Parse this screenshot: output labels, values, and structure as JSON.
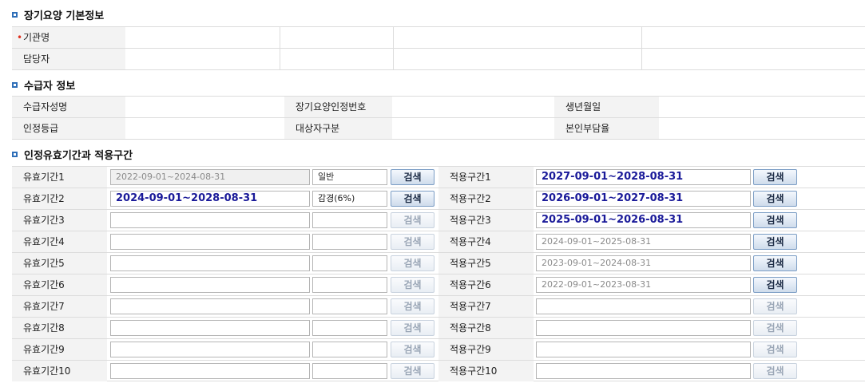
{
  "sections": {
    "basic": "장기요양 기본정보",
    "recipient": "수급자 정보",
    "period": "인정유효기간과 적용구간"
  },
  "basic_info": {
    "agency_label": "기관명",
    "manager_label": "담당자"
  },
  "recipient_info": {
    "name_label": "수급자성명",
    "ltc_number_label": "장기요양인정번호",
    "birth_label": "생년월일",
    "grade_label": "인정등급",
    "category_label": "대상자구분",
    "copay_label": "본인부담율"
  },
  "search_label": "검색",
  "period_rows": [
    {
      "label": "유효기간1",
      "value": "2022-09-01~2024-08-31",
      "type": "일반",
      "apply_label": "적용구간1",
      "apply_value": "2027-09-01~2028-08-31"
    },
    {
      "label": "유효기간2",
      "value": "2024-09-01~2028-08-31",
      "type": "감경(6%)",
      "apply_label": "적용구간2",
      "apply_value": "2026-09-01~2027-08-31"
    },
    {
      "label": "유효기간3",
      "value": "",
      "type": "",
      "apply_label": "적용구간3",
      "apply_value": "2025-09-01~2026-08-31"
    },
    {
      "label": "유효기간4",
      "value": "",
      "type": "",
      "apply_label": "적용구간4",
      "apply_value": "2024-09-01~2025-08-31"
    },
    {
      "label": "유효기간5",
      "value": "",
      "type": "",
      "apply_label": "적용구간5",
      "apply_value": "2023-09-01~2024-08-31"
    },
    {
      "label": "유효기간6",
      "value": "",
      "type": "",
      "apply_label": "적용구간6",
      "apply_value": "2022-09-01~2023-08-31"
    },
    {
      "label": "유효기간7",
      "value": "",
      "type": "",
      "apply_label": "적용구간7",
      "apply_value": ""
    },
    {
      "label": "유효기간8",
      "value": "",
      "type": "",
      "apply_label": "적용구간8",
      "apply_value": ""
    },
    {
      "label": "유효기간9",
      "value": "",
      "type": "",
      "apply_label": "적용구간9",
      "apply_value": ""
    },
    {
      "label": "유효기간10",
      "value": "",
      "type": "",
      "apply_label": "적용구간10",
      "apply_value": ""
    }
  ]
}
